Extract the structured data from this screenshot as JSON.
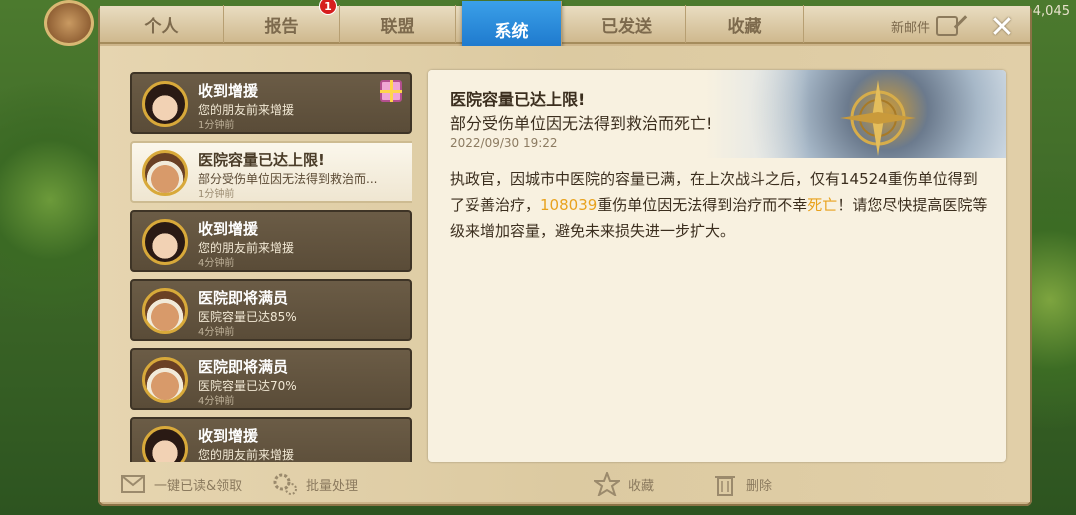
{
  "hud": {
    "resource_value": "4,045"
  },
  "tabs": [
    {
      "label": "个人"
    },
    {
      "label": "报告",
      "badge": "1"
    },
    {
      "label": "联盟"
    },
    {
      "label": "系统",
      "active": true
    },
    {
      "label": "已发送"
    },
    {
      "label": "收藏"
    }
  ],
  "new_mail_label": "新邮件",
  "close_label": "✕",
  "messages": [
    {
      "title": "收到增援",
      "sub": "您的朋友前来增援",
      "time": "1分钟前",
      "avatar": "woman",
      "gift": true
    },
    {
      "title": "医院容量已达上限!",
      "sub": "部分受伤单位因无法得到救治而...",
      "time": "1分钟前",
      "avatar": "man",
      "selected": true
    },
    {
      "title": "收到增援",
      "sub": "您的朋友前来增援",
      "time": "4分钟前",
      "avatar": "woman"
    },
    {
      "title": "医院即将满员",
      "sub": "医院容量已达85%",
      "time": "4分钟前",
      "avatar": "man"
    },
    {
      "title": "医院即将满员",
      "sub": "医院容量已达70%",
      "time": "4分钟前",
      "avatar": "man"
    },
    {
      "title": "收到增援",
      "sub": "您的朋友前来增援",
      "time": "",
      "avatar": "woman"
    }
  ],
  "detail": {
    "title": "医院容量已达上限!",
    "subtitle": "部分受伤单位因无法得到救治而死亡!",
    "date": "2022/09/30 19:22",
    "body_1": "执政官，因城市中医院的容量已满，在上次战斗之后，仅有14524重伤单位得到了妥善治疗，",
    "body_highlight_1": "108039",
    "body_2": "重伤单位因无法得到治疗而不幸",
    "body_highlight_2": "死亡",
    "body_3": "！请您尽快提高医院等级来增加容量，避免未来损失进一步扩大。"
  },
  "bottom": {
    "read_all": "一键已读&领取",
    "batch": "批量处理",
    "favorite": "收藏",
    "delete": "删除"
  },
  "colors": {
    "accent": "#1d7fd6",
    "highlight": "#e8a21e"
  }
}
